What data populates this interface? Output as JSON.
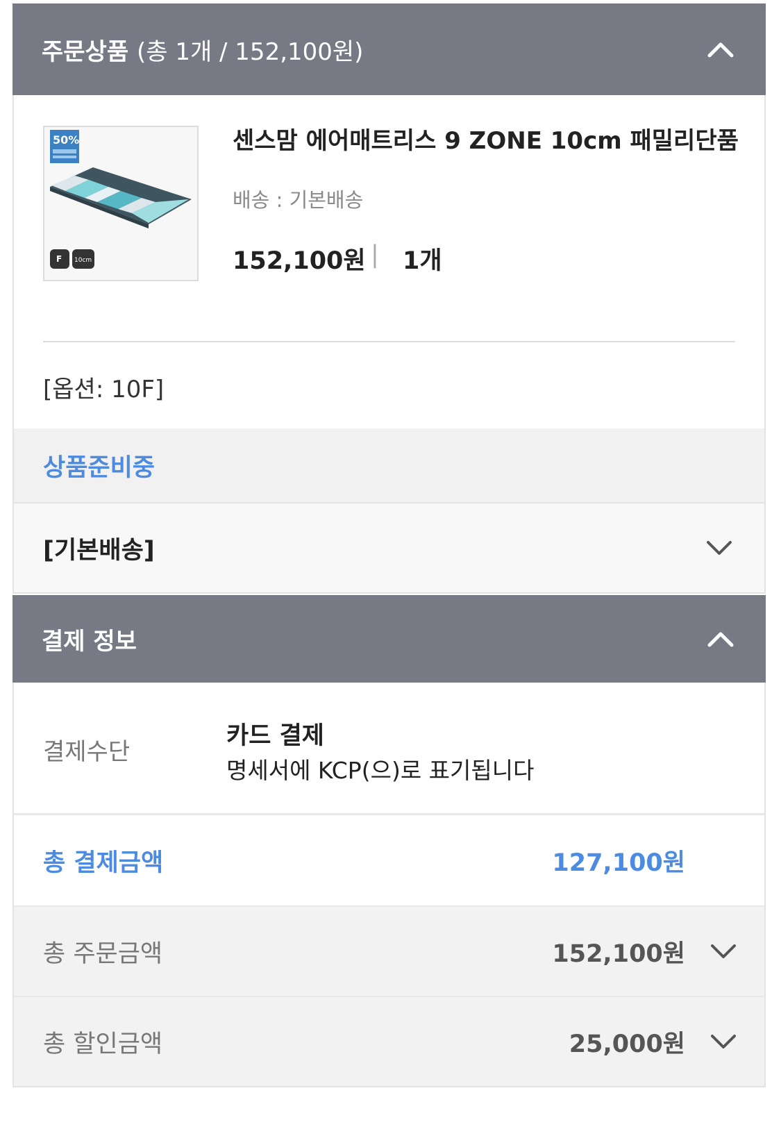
{
  "order_section": {
    "title": "주문상품",
    "summary": "(총 1개 / 152,100원)"
  },
  "product": {
    "name": "센스맘 에어매트리스 9 ZONE 10cm 패밀리단품",
    "shipping": "배송 : 기본배송",
    "price": "152,100원",
    "separator": "|",
    "qty": "1개",
    "option": "[옵션: 10F]",
    "thumb_badge": "50%",
    "thumb_tag1": "F",
    "thumb_tag2": "10cm"
  },
  "status": "상품준비중",
  "delivery": {
    "label": "[기본배송]"
  },
  "payment_section": {
    "title": "결제 정보"
  },
  "payment": {
    "method_label": "결제수단",
    "method_value": "카드 결제",
    "method_note": "명세서에 KCP(으)로 표기됩니다",
    "total_label": "총 결제금액",
    "total_value": "127,100원",
    "order_label": "총 주문금액",
    "order_value": "152,100원",
    "discount_label": "총 할인금액",
    "discount_value": "25,000원"
  },
  "colors": {
    "header": "#777a85",
    "accent": "#4d8be0"
  },
  "icons": {
    "collapse": "chevron-up-icon",
    "expand": "chevron-down-icon"
  }
}
